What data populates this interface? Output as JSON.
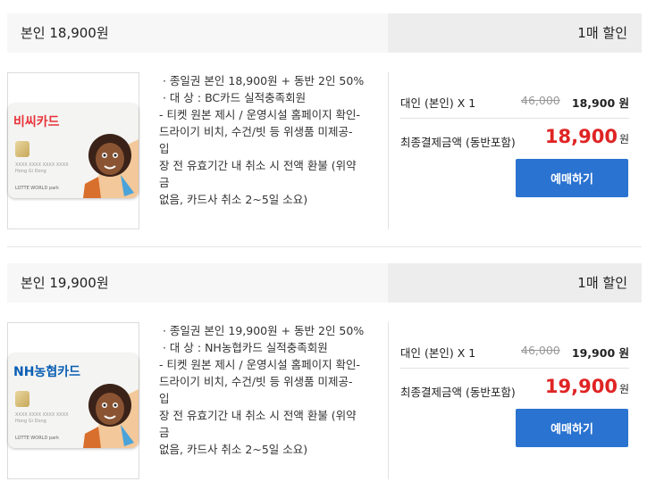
{
  "offers": [
    {
      "header_price": "본인 18,900원",
      "header_discount": "1매 할인",
      "card_logo": "비씨카드",
      "card_logo_color": "#e7333a",
      "card_number": "XXXX XXXX XXXX XXXX",
      "card_holder": "Hong Gi Dong",
      "card_brand": "LOTTE WORLD park",
      "desc": [
        " · 종일권 본인 18,900원 + 동반 2인 50%",
        " · 대 상 : BC카드 실적충족회원",
        "- 티켓 원본 제시 / 운영시설 홈페이지 확인-",
        "드라이기 비치, 수건/빗 등 위생품 미제공- 입",
        "장 전 유효기간 내 취소 시 전액 환불 (위약금",
        "없음, 카드사 취소 2~5일 소요)"
      ],
      "qty_label": "대인 (본인) X 1",
      "original_price": "46,000",
      "sale_price": "18,900 원",
      "total_label": "최종결제금액 (동반포함)",
      "total_amount": "18,900",
      "won": "원",
      "button_label": "예매하기"
    },
    {
      "header_price": "본인 19,900원",
      "header_discount": "1매 할인",
      "card_logo": "NH농협카드",
      "card_logo_color": "#0a5fb4",
      "card_number": "XXXX XXXX XXXX XXXX",
      "card_holder": "Hong Gi Dong",
      "card_brand": "LOTTE WORLD park",
      "desc": [
        " · 종일권 본인 19,900원 + 동반 2인 50%",
        " · 대 상 : NH농협카드 실적충족회원",
        "- 티켓 원본 제시 / 운영시설 홈페이지 확인-",
        "드라이기 비치, 수건/빗 등 위생품 미제공- 입",
        "장 전 유효기간 내 취소 시 전액 환불 (위약금",
        "없음, 카드사 취소 2~5일 소요)"
      ],
      "qty_label": "대인 (본인) X 1",
      "original_price": "46,000",
      "sale_price": "19,900 원",
      "total_label": "최종결제금액 (동반포함)",
      "total_amount": "19,900",
      "won": "원",
      "button_label": "예매하기"
    }
  ],
  "colors": {
    "accent": "#2a73d1",
    "total_price": "#e02424"
  }
}
